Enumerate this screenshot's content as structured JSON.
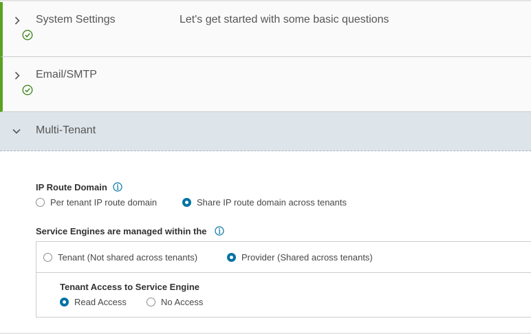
{
  "sections": [
    {
      "title": "System Settings",
      "description": "Let's get started with some basic questions",
      "completed": true,
      "expanded": false
    },
    {
      "title": "Email/SMTP",
      "completed": true,
      "expanded": false
    },
    {
      "title": "Multi-Tenant",
      "completed": false,
      "expanded": true
    }
  ],
  "multi_tenant": {
    "ip_route_domain": {
      "label": "IP Route Domain",
      "options": [
        "Per tenant IP route domain",
        "Share IP route domain across tenants"
      ],
      "selected": "Share IP route domain across tenants"
    },
    "service_engines": {
      "label": "Service Engines are managed within the",
      "options": [
        "Tenant (Not shared across tenants)",
        "Provider (Shared across tenants)"
      ],
      "selected": "Provider (Shared across tenants)"
    },
    "tenant_access": {
      "label": "Tenant Access to Service Engine",
      "options": [
        "Read Access",
        "No Access"
      ],
      "selected": "Read Access"
    }
  },
  "colors": {
    "success": "#5aa220",
    "accent": "#0072a3",
    "active_header": "#dde4ea"
  }
}
